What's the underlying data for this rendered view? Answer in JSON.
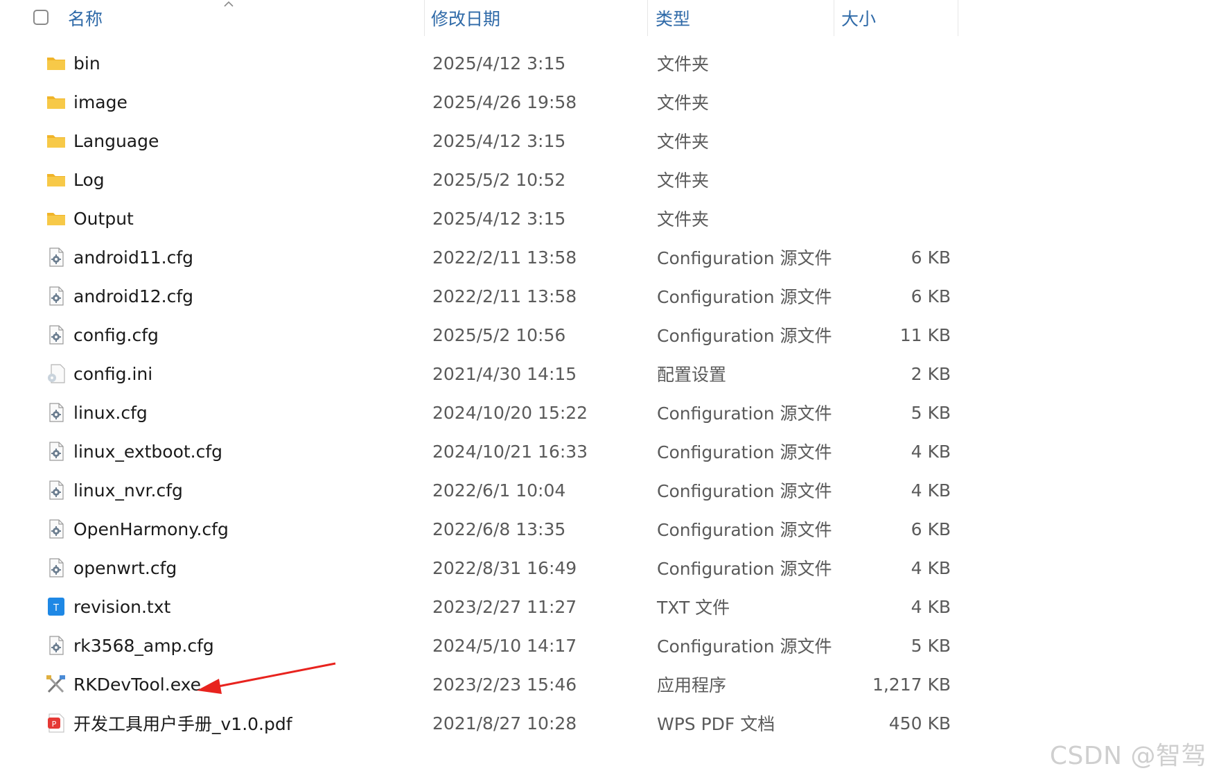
{
  "header": {
    "name_label": "名称",
    "date_label": "修改日期",
    "type_label": "类型",
    "size_label": "大小"
  },
  "rows": [
    {
      "name": "bin",
      "date": "2025/4/12 3:15",
      "type": "文件夹",
      "size": "",
      "icon": "folder-icon"
    },
    {
      "name": "image",
      "date": "2025/4/26 19:58",
      "type": "文件夹",
      "size": "",
      "icon": "folder-icon"
    },
    {
      "name": "Language",
      "date": "2025/4/12 3:15",
      "type": "文件夹",
      "size": "",
      "icon": "folder-icon"
    },
    {
      "name": "Log",
      "date": "2025/5/2 10:52",
      "type": "文件夹",
      "size": "",
      "icon": "folder-icon"
    },
    {
      "name": "Output",
      "date": "2025/4/12 3:15",
      "type": "文件夹",
      "size": "",
      "icon": "folder-icon"
    },
    {
      "name": "android11.cfg",
      "date": "2022/2/11 13:58",
      "type": "Configuration 源文件",
      "size": "6 KB",
      "icon": "config-file-icon"
    },
    {
      "name": "android12.cfg",
      "date": "2022/2/11 13:58",
      "type": "Configuration 源文件",
      "size": "6 KB",
      "icon": "config-file-icon"
    },
    {
      "name": "config.cfg",
      "date": "2025/5/2 10:56",
      "type": "Configuration 源文件",
      "size": "11 KB",
      "icon": "config-file-icon"
    },
    {
      "name": "config.ini",
      "date": "2021/4/30 14:15",
      "type": "配置设置",
      "size": "2 KB",
      "icon": "ini-file-icon"
    },
    {
      "name": "linux.cfg",
      "date": "2024/10/20 15:22",
      "type": "Configuration 源文件",
      "size": "5 KB",
      "icon": "config-file-icon"
    },
    {
      "name": "linux_extboot.cfg",
      "date": "2024/10/21 16:33",
      "type": "Configuration 源文件",
      "size": "4 KB",
      "icon": "config-file-icon"
    },
    {
      "name": "linux_nvr.cfg",
      "date": "2022/6/1 10:04",
      "type": "Configuration 源文件",
      "size": "4 KB",
      "icon": "config-file-icon"
    },
    {
      "name": "OpenHarmony.cfg",
      "date": "2022/6/8 13:35",
      "type": "Configuration 源文件",
      "size": "6 KB",
      "icon": "config-file-icon"
    },
    {
      "name": "openwrt.cfg",
      "date": "2022/8/31 16:49",
      "type": "Configuration 源文件",
      "size": "4 KB",
      "icon": "config-file-icon"
    },
    {
      "name": "revision.txt",
      "date": "2023/2/27 11:27",
      "type": "TXT 文件",
      "size": "4 KB",
      "icon": "text-file-icon"
    },
    {
      "name": "rk3568_amp.cfg",
      "date": "2024/5/10 14:17",
      "type": "Configuration 源文件",
      "size": "5 KB",
      "icon": "config-file-icon"
    },
    {
      "name": "RKDevTool.exe",
      "date": "2023/2/23 15:46",
      "type": "应用程序",
      "size": "1,217 KB",
      "icon": "tools-app-icon"
    },
    {
      "name": "开发工具用户手册_v1.0.pdf",
      "date": "2021/8/27 10:28",
      "type": "WPS PDF 文档",
      "size": "450 KB",
      "icon": "pdf-file-icon"
    }
  ],
  "colors": {
    "header_text": "#2f6aa8",
    "folder": "#f7c948",
    "text_file": "#1e88e5",
    "pdf": "#e53935",
    "annotation_arrow": "#e8231e"
  },
  "watermark": "CSDN @智驾"
}
